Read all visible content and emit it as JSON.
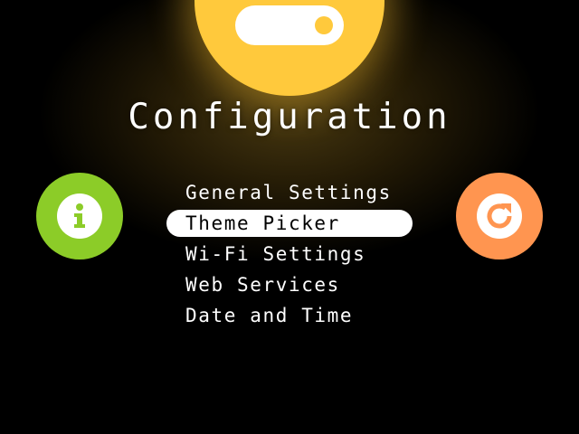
{
  "header": {
    "title": "Configuration",
    "icon": "toggle-switch-icon",
    "accent_color": "#ffc93c"
  },
  "menu": {
    "selected_index": 1,
    "items": [
      {
        "label": "General Settings"
      },
      {
        "label": "Theme Picker"
      },
      {
        "label": "Wi-Fi Settings"
      },
      {
        "label": "Web Services"
      },
      {
        "label": "Date and Time"
      }
    ]
  },
  "side_buttons": {
    "left": {
      "icon": "info-icon",
      "color": "#8ccc28"
    },
    "right": {
      "icon": "refresh-icon",
      "color": "#ff9550"
    }
  },
  "colors": {
    "background": "#000000",
    "text": "#ffffff",
    "selection_bg": "#ffffff",
    "selection_text": "#000000"
  }
}
